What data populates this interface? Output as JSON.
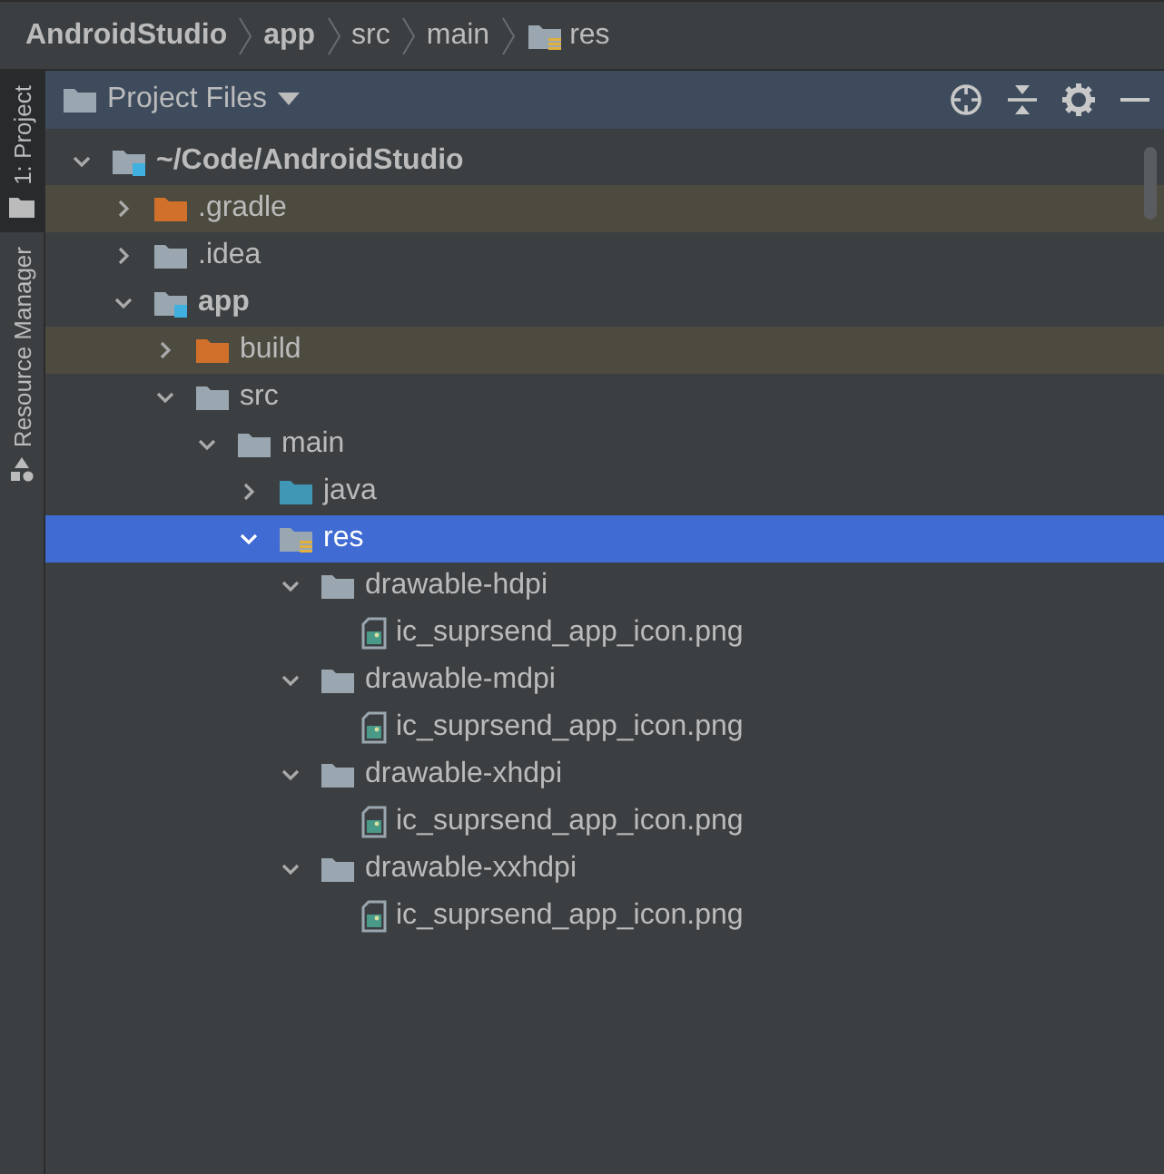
{
  "breadcrumbs": [
    {
      "label": "AndroidStudio",
      "kind": "module"
    },
    {
      "label": "app",
      "kind": "module"
    },
    {
      "label": "src",
      "kind": "folder"
    },
    {
      "label": "main",
      "kind": "folder"
    },
    {
      "label": "res",
      "kind": "resources"
    }
  ],
  "side_tabs": [
    {
      "label": "1: Project",
      "selected": true
    },
    {
      "label": "Resource Manager",
      "selected": false
    }
  ],
  "panel": {
    "title": "Project Files"
  },
  "tree": [
    {
      "label": "~/Code/AndroidStudio",
      "kind": "module",
      "expanded": true,
      "selected": false,
      "children": [
        {
          "label": ".gradle",
          "kind": "excluded",
          "expanded": false,
          "selected": false
        },
        {
          "label": ".idea",
          "kind": "plain",
          "expanded": false,
          "selected": false
        },
        {
          "label": "app",
          "kind": "module",
          "expanded": true,
          "selected": false,
          "children": [
            {
              "label": "build",
              "kind": "excluded",
              "expanded": false,
              "selected": false
            },
            {
              "label": "src",
              "kind": "plain",
              "expanded": true,
              "selected": false,
              "children": [
                {
                  "label": "main",
                  "kind": "plain",
                  "expanded": true,
                  "selected": false,
                  "children": [
                    {
                      "label": "java",
                      "kind": "source",
                      "expanded": false,
                      "selected": false
                    },
                    {
                      "label": "res",
                      "kind": "resources",
                      "expanded": true,
                      "selected": true,
                      "children": [
                        {
                          "label": "drawable-hdpi",
                          "kind": "plain",
                          "expanded": true,
                          "selected": false,
                          "children": [
                            {
                              "label": "ic_suprsend_app_icon.png",
                              "kind": "image",
                              "selected": false
                            }
                          ]
                        },
                        {
                          "label": "drawable-mdpi",
                          "kind": "plain",
                          "expanded": true,
                          "selected": false,
                          "children": [
                            {
                              "label": "ic_suprsend_app_icon.png",
                              "kind": "image",
                              "selected": false
                            }
                          ]
                        },
                        {
                          "label": "drawable-xhdpi",
                          "kind": "plain",
                          "expanded": true,
                          "selected": false,
                          "children": [
                            {
                              "label": "ic_suprsend_app_icon.png",
                              "kind": "image",
                              "selected": false
                            }
                          ]
                        },
                        {
                          "label": "drawable-xxhdpi",
                          "kind": "plain",
                          "expanded": true,
                          "selected": false,
                          "children": [
                            {
                              "label": "ic_suprsend_app_icon.png",
                              "kind": "image",
                              "selected": false
                            }
                          ]
                        }
                      ]
                    }
                  ]
                }
              ]
            }
          ]
        }
      ]
    }
  ]
}
